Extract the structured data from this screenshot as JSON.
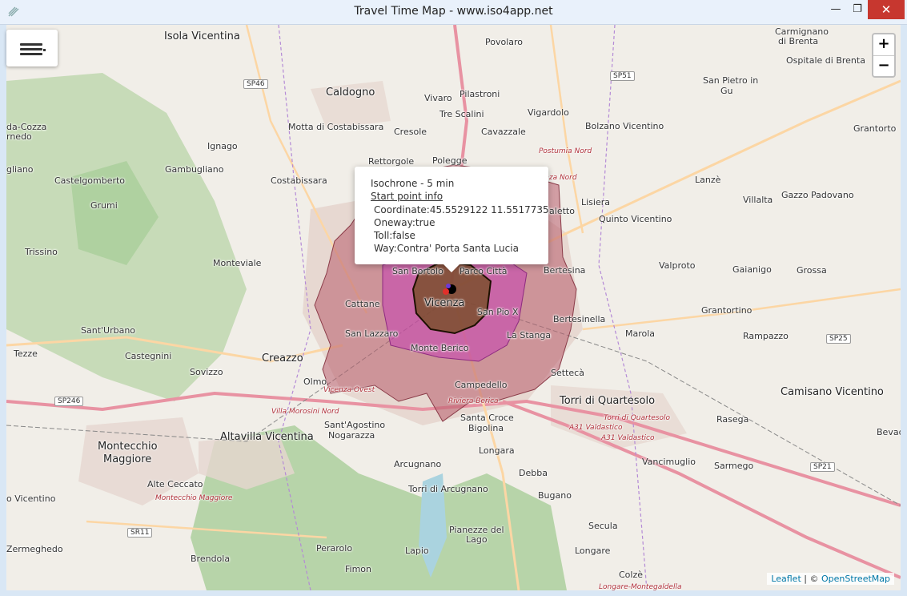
{
  "window": {
    "title": "Travel Time Map - www.iso4app.net",
    "minimize": "—",
    "maximize": "❐",
    "close": "✕"
  },
  "controls": {
    "menu_icon": "hamburger-icon",
    "zoom_in": "+",
    "zoom_out": "−"
  },
  "popup": {
    "title": "Isochrone - 5 min",
    "link": "Start point info",
    "coordinate": "Coordinate:45.5529122 11.5517735",
    "oneway": "Oneway:true",
    "toll": "Toll:false",
    "way": "Way:Contra' Porta Santa Lucia"
  },
  "attribution": {
    "leaflet": "Leaflet",
    "sep": " | © ",
    "osm": "OpenStreetMap"
  },
  "colors": {
    "isochrone_outer": "#b85d6b",
    "isochrone_middle": "#c63fb2",
    "isochrone_inner": "#6b4a12",
    "map_background": "#f1eee8",
    "forest": "#a4c99a",
    "urban": "#e4cfc6"
  },
  "places": {
    "isola_vicentina": "Isola Vicentina",
    "povolaro": "Povolaro",
    "carmignano": "Carmignano",
    "di_brenta": "di Brenta",
    "ospitale": "Ospitale di Brenta",
    "sp51": "SP51",
    "sp46": "SP46",
    "san_pietro": "San Pietro in",
    "gu": "Gu",
    "caldogno": "Caldogno",
    "vivaro": "Vivaro",
    "pilastroni": "Pilastroni",
    "tre_scalini": "Tre Scalini",
    "vigardolo": "Vigardolo",
    "motta": "Motta di Costabissara",
    "cresole": "Cresole",
    "cavazzale": "Cavazzale",
    "bolzano": "Bolzano Vicentino",
    "grantorto": "Grantorto",
    "da_cozza": "da-Cozza",
    "rnedo": "rnedo",
    "ignago": "Ignago",
    "rettorgole": "Rettorgole",
    "polegge": "Polegge",
    "postumia": "Postumia Nord",
    "gliano": "gliano",
    "gambugliano": "Gambugliano",
    "costabissara": "Costabissara",
    "vicenza_nord": "Vicenza Nord",
    "castelgomberto": "Castelgomberto",
    "lanze": "Lanzè",
    "grumi": "Grumi",
    "lisiera": "Lisiera",
    "villalta": "Villalta",
    "gazzo": "Gazzo Padovano",
    "laletto": "laletto",
    "quinto": "Quinto Vicentino",
    "trissino": "Trissino",
    "monteviale": "Monteviale",
    "valproto": "Valproto",
    "gaianigo": "Gaianigo",
    "grossa": "Grossa",
    "san_bortolo": "San Bortolo",
    "parco_citta": "Parco Città",
    "bertesina": "Bertesina",
    "vicenza": "Vicenza",
    "cattane": "Cattane",
    "san_pio": "San Pio X",
    "grantortino": "Grantortino",
    "santurbano": "Sant'Urbano",
    "bertesinella": "Bertesinella",
    "san_lazzaro": "San Lazzaro",
    "la_stanga": "La Stanga",
    "marola": "Marola",
    "rampazzo": "Rampazzo",
    "tezze": "Tezze",
    "castegnini": "Castegnini",
    "monte_berico": "Monte Berico",
    "sp25": "SP25",
    "creazzo": "Creazzo",
    "sovizzo": "Sovizzo",
    "settecà": "Settecà",
    "olmo": "Olmo",
    "vicenza_ovest": "Vicenza Ovest",
    "campedello": "Campedello",
    "camisano": "Camisano Vicentino",
    "sp246": "SP246",
    "riviera_berica": "Riviera Berica",
    "torri": "Torri di Quartesolo",
    "villa_morosini": "Villa Morosini Nord",
    "torri_small": "Torri di Quartesolo",
    "rasega": "Rasega",
    "santagostino": "Sant'Agostino",
    "santa_croce": "Santa Croce",
    "a31a": "A31 Valdastico",
    "bevad": "Bevad",
    "altavilla": "Altavilla Vicentina",
    "nogarazza": "Nogarazza",
    "bigolina": "Bigolina",
    "a31b": "A31 Valdastico",
    "montecchio": "Montecchio",
    "maggiore": "Maggiore",
    "longara": "Longara",
    "vancimuglio": "Vancimuglio",
    "arcugnano": "Arcugnano",
    "sarmego": "Sarmego",
    "sp21": "SP21",
    "alte_ceccato": "Alte Ceccato",
    "debba": "Debba",
    "torri_arcugnano": "Torri di Arcugnano",
    "o_vicentino": "o Vicentino",
    "montecchio_m": "Montecchio Maggiore",
    "bugano": "Bugano",
    "sr11": "SR11",
    "pianezze": "Pianezze del",
    "lago": "Lago",
    "secula": "Secula",
    "zermeghedo": "Zermeghedo",
    "perarolo": "Perarolo",
    "lapio": "Lapio",
    "longare": "Longare",
    "brendola": "Brendola",
    "fimon": "Fimon",
    "colze": "Colzè",
    "longare_m": "Longare-Montegaldella"
  }
}
